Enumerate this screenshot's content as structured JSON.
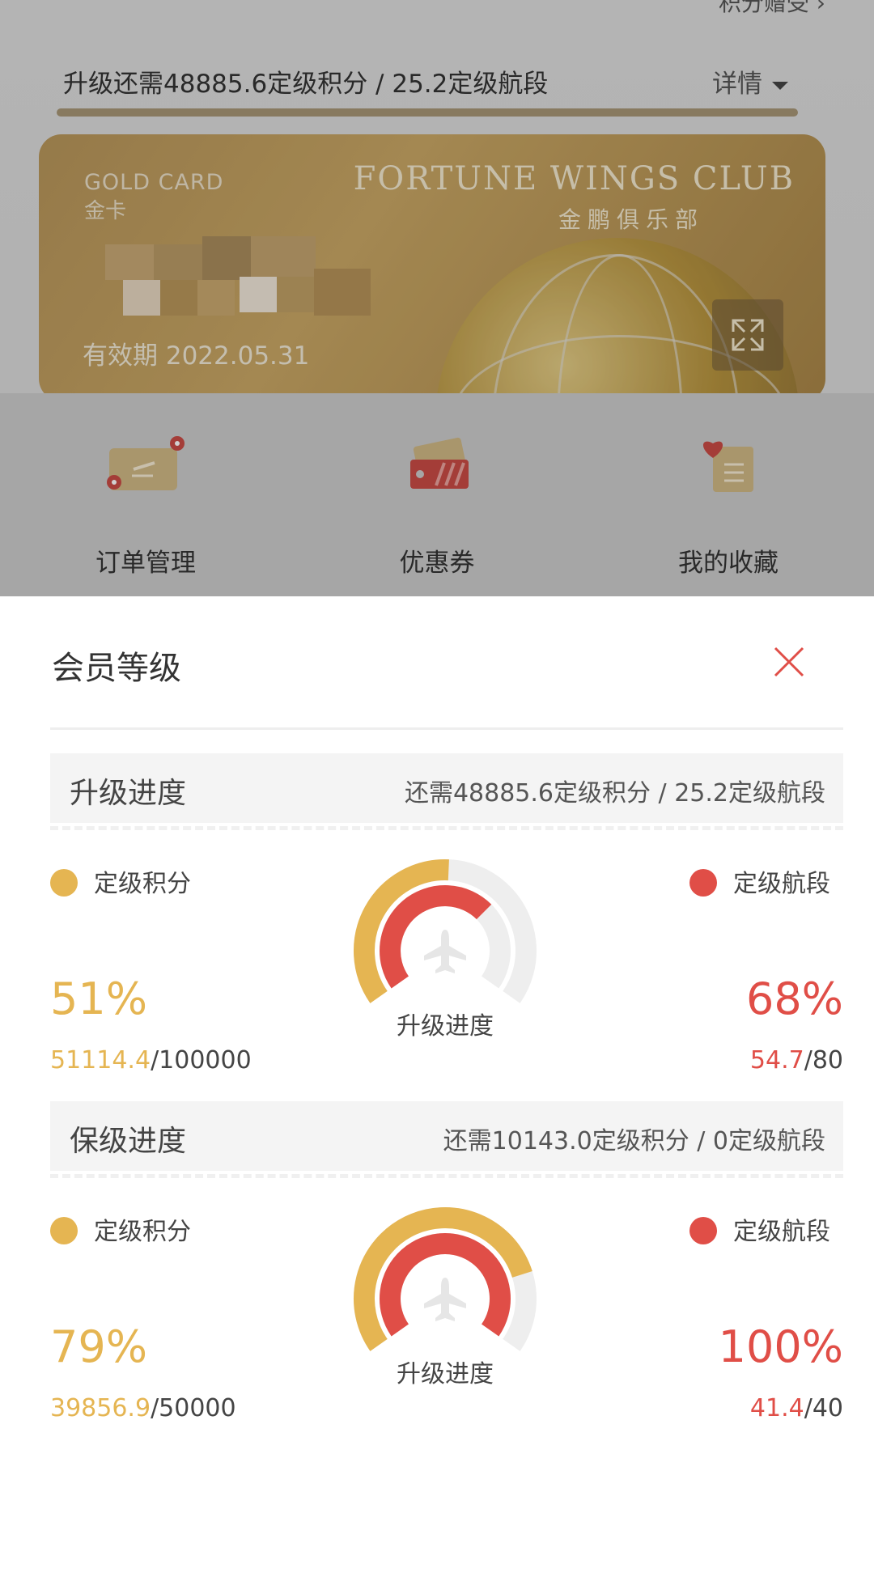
{
  "background_page": {
    "top_link": "积分赠受",
    "upgrade_text": "升级还需48885.6定级积分 / 25.2定级航段",
    "detail_label": "详情",
    "card": {
      "type_en": "GOLD CARD",
      "type_cn": "金卡",
      "club_en": "FORTUNE WINGS CLUB",
      "club_cn": "金鹏俱乐部",
      "valid_until": "有效期 2022.05.31"
    },
    "menu": [
      {
        "label": "订单管理",
        "icon": "order-ticket-icon"
      },
      {
        "label": "优惠券",
        "icon": "coupon-icon"
      },
      {
        "label": "我的收藏",
        "icon": "favorites-icon"
      }
    ]
  },
  "sheet": {
    "title": "会员等级",
    "sections": [
      {
        "name": "升级进度",
        "need": "还需48885.6定级积分 / 25.2定级航段",
        "points_legend": "定级积分",
        "segments_legend": "定级航段",
        "points_pct": "51%",
        "points_value": "51114.4",
        "points_total": "/100000",
        "points_fraction": 0.51,
        "segments_pct": "68%",
        "segments_value": "54.7",
        "segments_total": "/80",
        "segments_fraction": 0.68,
        "gauge_label": "升级进度"
      },
      {
        "name": "保级进度",
        "need": "还需10143.0定级积分 / 0定级航段",
        "points_legend": "定级积分",
        "segments_legend": "定级航段",
        "points_pct": "79%",
        "points_value": "39856.9",
        "points_total": "/50000",
        "points_fraction": 0.79,
        "segments_pct": "100%",
        "segments_value": "41.4",
        "segments_total": "/40",
        "segments_fraction": 1.0,
        "gauge_label": "升级进度"
      }
    ]
  },
  "colors": {
    "gold": "#e5b552",
    "red": "#e04e47",
    "track": "#eeeeee"
  }
}
